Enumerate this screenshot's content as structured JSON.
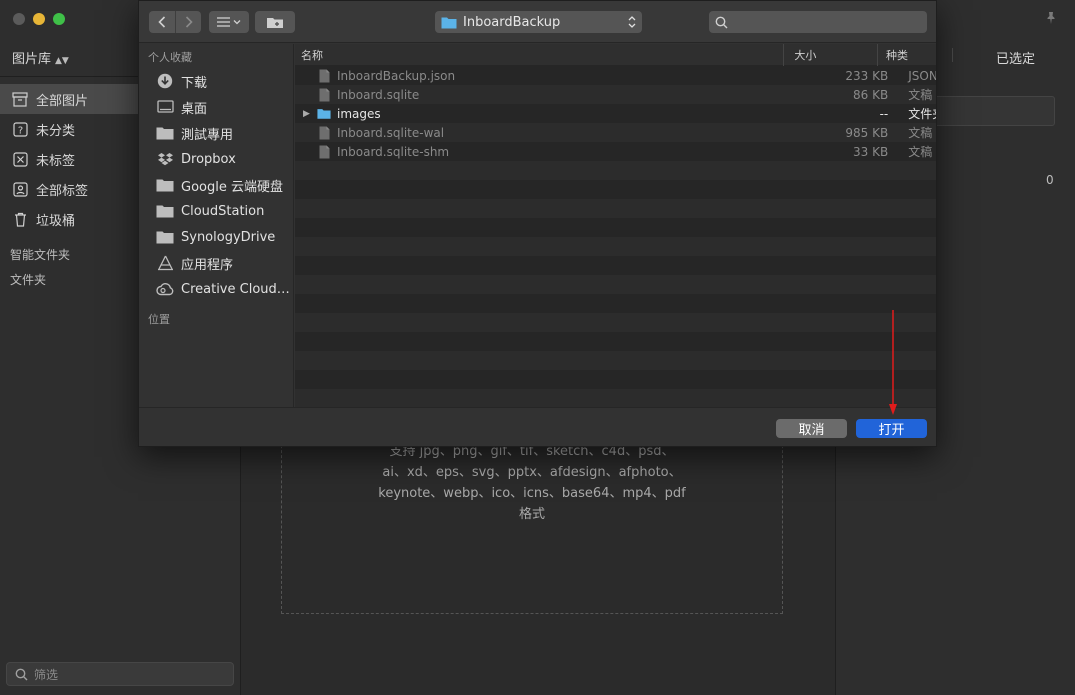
{
  "app": {
    "library_label": "图片库",
    "nav": [
      {
        "label": "全部图片",
        "icon": "archive-icon",
        "active": true
      },
      {
        "label": "未分类",
        "icon": "question-box-icon",
        "active": false
      },
      {
        "label": "未标签",
        "icon": "untagged-icon",
        "active": false
      },
      {
        "label": "全部标签",
        "icon": "tag-icon",
        "active": false
      },
      {
        "label": "垃圾桶",
        "icon": "trash-icon",
        "active": false
      }
    ],
    "smart_folders_label": "智能文件夹",
    "folders_label": "文件夹",
    "filter_placeholder": "筛选",
    "drop_hint_lines": [
      "支持 jpg、png、gif、tif、sketch、c4d、psd、",
      "ai、xd、eps、svg、pptx、afdesign、afphoto、",
      "keynote、webp、ico、icns、base64、mp4、pdf",
      "格式"
    ],
    "right_tab_selected": "已选定",
    "right_count": "0"
  },
  "dialog": {
    "location": "InboardBackup",
    "search_placeholder": "",
    "favorites_label": "个人收藏",
    "locations_label": "位置",
    "favorites": [
      {
        "label": "下载",
        "icon": "download-icon"
      },
      {
        "label": "桌面",
        "icon": "desktop-icon"
      },
      {
        "label": "測試專用",
        "icon": "folder-icon"
      },
      {
        "label": "Dropbox",
        "icon": "dropbox-icon"
      },
      {
        "label": "Google 云端硬盘",
        "icon": "folder-icon"
      },
      {
        "label": "CloudStation",
        "icon": "folder-icon"
      },
      {
        "label": "SynologyDrive",
        "icon": "folder-icon"
      },
      {
        "label": "应用程序",
        "icon": "applications-icon"
      },
      {
        "label": "Creative Cloud…",
        "icon": "creative-cloud-icon"
      }
    ],
    "columns": {
      "name": "名称",
      "size": "大小",
      "kind": "种类"
    },
    "files": [
      {
        "name": "InboardBackup.json",
        "size": "233 KB",
        "kind": "JSON",
        "type": "file",
        "enabled": false
      },
      {
        "name": "Inboard.sqlite",
        "size": "86 KB",
        "kind": "文稿",
        "type": "file",
        "enabled": false
      },
      {
        "name": "images",
        "size": "--",
        "kind": "文件夹",
        "type": "folder",
        "enabled": true
      },
      {
        "name": "Inboard.sqlite-wal",
        "size": "985 KB",
        "kind": "文稿",
        "type": "file",
        "enabled": false
      },
      {
        "name": "Inboard.sqlite-shm",
        "size": "33 KB",
        "kind": "文稿",
        "type": "file",
        "enabled": false
      }
    ],
    "empty_rows": 13,
    "cancel_label": "取消",
    "open_label": "打开"
  },
  "colors": {
    "accent": "#2164d9",
    "annotation_arrow": "#e01c1c",
    "folder": "#5bb3e8"
  }
}
